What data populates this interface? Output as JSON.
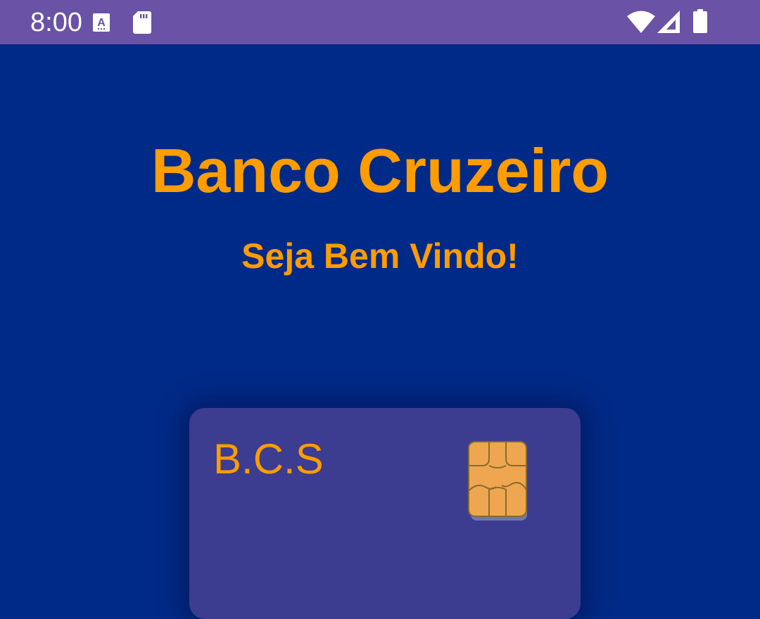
{
  "status_bar": {
    "time": "8:00",
    "background_color": "#6a52a6",
    "icons": [
      "font-a-icon",
      "sd-card-icon",
      "wifi-icon",
      "signal-icon",
      "battery-icon"
    ]
  },
  "main": {
    "background_color": "#002a87",
    "title": "Banco Cruzeiro",
    "subtitle": "Seja Bem Vindo!",
    "accent_color": "#ff9c00"
  },
  "card": {
    "name": "B.C.S",
    "background_color": "#3c3d90",
    "chip_icon": "card-chip-icon"
  }
}
